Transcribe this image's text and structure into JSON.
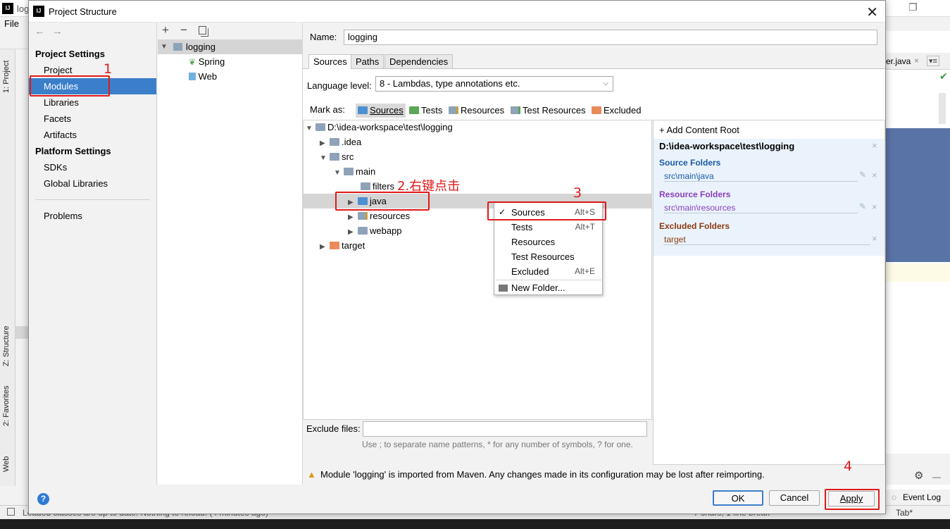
{
  "ide": {
    "title_partial": "log",
    "menu_file": "File",
    "tab_project": "1: Project",
    "tab_structure": "Z: Structure",
    "tab_favorites": "2: Favorites",
    "tab_web": "Web",
    "editor_tab": "er.java",
    "event_log": "Event Log",
    "status_text": "Loaded classes are up to date. Nothing to reload. (4 minutes ago)",
    "status_right": "7 chars, 1 line break",
    "tab_label": "Tab*"
  },
  "dialog": {
    "title": "Project Structure",
    "nav": {
      "project_settings": "Project Settings",
      "items1": [
        "Project",
        "Modules",
        "Libraries",
        "Facets",
        "Artifacts"
      ],
      "platform_settings": "Platform Settings",
      "items2": [
        "SDKs",
        "Global Libraries"
      ],
      "problems": "Problems"
    },
    "modules": {
      "root": "logging",
      "children": [
        "Spring",
        "Web"
      ]
    },
    "name_label": "Name:",
    "name_value": "logging",
    "tabs": [
      "Sources",
      "Paths",
      "Dependencies"
    ],
    "language_level_label": "Language level:",
    "language_level_value": "8 - Lambdas, type annotations etc.",
    "mark_as_label": "Mark as:",
    "mark_as": [
      "Sources",
      "Tests",
      "Resources",
      "Test Resources",
      "Excluded"
    ],
    "tree": {
      "root": "D:\\idea-workspace\\test\\logging",
      "idea": ".idea",
      "src": "src",
      "main": "main",
      "filters": "filters",
      "java": "java",
      "resources": "resources",
      "webapp": "webapp",
      "target": "target"
    },
    "context_menu": [
      {
        "label": "Sources",
        "shortcut": "Alt+S",
        "checked": true
      },
      {
        "label": "Tests",
        "shortcut": "Alt+T"
      },
      {
        "label": "Resources",
        "shortcut": ""
      },
      {
        "label": "Test Resources",
        "shortcut": ""
      },
      {
        "label": "Excluded",
        "shortcut": "Alt+E"
      },
      {
        "label": "New Folder...",
        "shortcut": ""
      }
    ],
    "root_panel": {
      "add_content_root": "+ Add Content Root",
      "root_path": "D:\\idea-workspace\\test\\logging",
      "source_folders": "Source Folders",
      "source_path": "src\\main\\java",
      "resource_folders": "Resource Folders",
      "resource_path": "src\\main\\resources",
      "excluded_folders": "Excluded Folders",
      "excluded_path": "target"
    },
    "exclude_files_label": "Exclude files:",
    "exclude_files_value": "",
    "exclude_hint": "Use ; to separate name patterns, * for any number of symbols, ? for one.",
    "warning": "Module 'logging' is imported from Maven. Any changes made in its configuration may be lost after reimporting.",
    "buttons": {
      "ok": "OK",
      "cancel": "Cancel",
      "apply": "Apply",
      "help": "?"
    }
  },
  "annotations": {
    "a1": "1",
    "a2": "2.右键点击",
    "a3": "3",
    "a4": "4"
  },
  "colors": {
    "selection": "#3b7fcb",
    "annotation_red": "#e01a1a",
    "sources_blue": "#4d8fd0",
    "tests_green": "#5aa656",
    "resources_yellow": "#c7a23c",
    "excluded_orange": "#e98a5a",
    "source_folders_title": "#1b5aa8",
    "resource_folders_title": "#8a3fbf",
    "excluded_folders_title": "#8b3a10"
  }
}
